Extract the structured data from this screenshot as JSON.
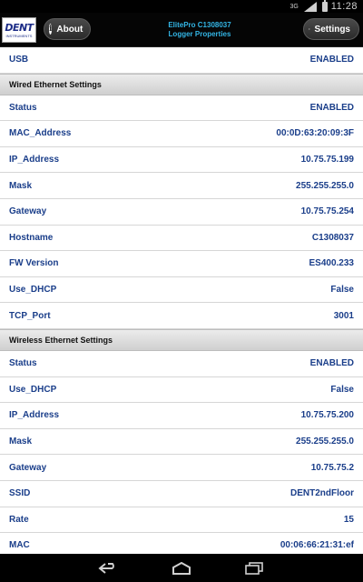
{
  "status_bar": {
    "network": "3G",
    "time": "11:28"
  },
  "header": {
    "logo_text": "DENT",
    "logo_subtext": "INSTRUMENTS",
    "about_label": "About",
    "settings_label": "Settings",
    "title_line1": "ElitePro C1308037",
    "title_line2": "Logger Properties"
  },
  "rows_top": [
    {
      "label": "USB",
      "value": "ENABLED"
    }
  ],
  "wired": {
    "header": "Wired Ethernet Settings",
    "rows": [
      {
        "label": "Status",
        "value": "ENABLED"
      },
      {
        "label": "MAC_Address",
        "value": "00:0D:63:20:09:3F"
      },
      {
        "label": "IP_Address",
        "value": "10.75.75.199"
      },
      {
        "label": "Mask",
        "value": "255.255.255.0"
      },
      {
        "label": "Gateway",
        "value": "10.75.75.254"
      },
      {
        "label": "Hostname",
        "value": "C1308037"
      },
      {
        "label": "FW Version",
        "value": "ES400.233"
      },
      {
        "label": "Use_DHCP",
        "value": "False"
      },
      {
        "label": "TCP_Port",
        "value": "3001"
      }
    ]
  },
  "wireless": {
    "header": "Wireless Ethernet Settings",
    "rows": [
      {
        "label": "Status",
        "value": "ENABLED"
      },
      {
        "label": "Use_DHCP",
        "value": "False"
      },
      {
        "label": "IP_Address",
        "value": "10.75.75.200"
      },
      {
        "label": "Mask",
        "value": "255.255.255.0"
      },
      {
        "label": "Gateway",
        "value": "10.75.75.2"
      },
      {
        "label": "SSID",
        "value": "DENT2ndFloor"
      },
      {
        "label": "Rate",
        "value": "15"
      },
      {
        "label": "MAC",
        "value": "00:06:66:21:31:ef"
      }
    ]
  },
  "nav": {
    "back_icon": "back-icon",
    "home_icon": "home-icon",
    "recents_icon": "recents-icon"
  }
}
